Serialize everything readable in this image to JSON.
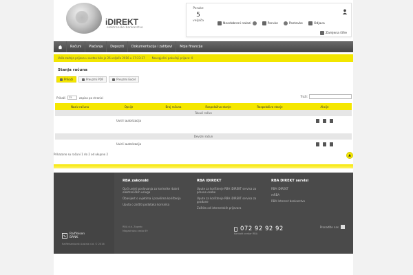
{
  "header": {
    "brand": "iDIREKT",
    "brand_subtitle": "elektronsko bankarstvo",
    "messages_label": "Poruke",
    "messages_count": "5",
    "messages_word": "veljača",
    "links": [
      {
        "label": "Neodobreni nalozi",
        "icon": "document-icon"
      },
      {
        "label": "Poruke",
        "icon": "envelope-icon"
      },
      {
        "label": "Postavke",
        "icon": "gear-icon"
      },
      {
        "label": "Odjava",
        "icon": "logout-icon"
      }
    ],
    "link_extra": "Zamjena šifre",
    "user_icon": "user-icon"
  },
  "nav": {
    "items": [
      "Računi",
      "Plaćanja",
      "Depoziti",
      "Dokumentacija i zahtjevi",
      "Moje financije"
    ]
  },
  "info_bar": {
    "text1": "Vaša zadnja prijava u sustav bila je 26.veljača 2016 u 17:23:37",
    "text2": "Neuspješni pokušaji prijave: 0"
  },
  "content": {
    "title": "Stanja računa",
    "tabs": [
      {
        "label": "Prikaži",
        "active": true
      },
      {
        "label": "Preuzmi PDF",
        "active": false
      },
      {
        "label": "Preuzmi Excel",
        "active": false
      }
    ],
    "show_label": "Prikaži",
    "show_value": "25",
    "show_suffix": "zapisa po stranici",
    "search_label": "Traži:",
    "columns": [
      "Naziv računa",
      "Opcije",
      "Broj računa",
      "Raspoloživo stanje",
      "Raspoloživo stanje",
      "Akcije"
    ],
    "sections": [
      {
        "label": "Tekući račun",
        "row_option": "Uvid i autorizacija"
      },
      {
        "label": "Devizni račun",
        "row_option": "Uvid i autorizacija"
      }
    ],
    "summary": "Prikazano su računi 1 do 2 od ukupno 2",
    "scroll_top": "▲"
  },
  "footer": {
    "col1_title": "RBA zakonski",
    "col1_items": [
      "Opći uvjeti poslovanja za korisnike rbaint elektroničkih usluga",
      "Obavijest o uvjetima i pravilima korištenja",
      "Uputa o zaštiti podataka korisnika"
    ],
    "col2_title": "RBA iDIREKT",
    "col2_items": [
      "Upute za korištenje RBA iDIREKT servisa za pravne osobe",
      "Upute za korištenje RBA iDIREKT servisa za građane",
      "Zaštita od internetskih prijevara"
    ],
    "col3_title": "RBA DIREKT servisi",
    "col3_items": [
      "RBA iDIREKT",
      "mRBA",
      "RBA Internet bankarstvo"
    ],
    "phone": "072 92 92 92",
    "phone_sub": "Kontakt centar RBA",
    "facebook": "Pronađite nas",
    "small_lines": [
      "RBA d.d. Zagreb",
      "Magazinska cesta 69"
    ],
    "logo_line1": "Raiffeisen",
    "logo_line2": "BANK",
    "logo_sub": "Raiffeisenbank Austria d.d. © 2016"
  },
  "colors": {
    "accent_yellow": "#f5e700",
    "nav_dark": "#4a4a4a",
    "footer_bg": "#4a4a4a"
  }
}
